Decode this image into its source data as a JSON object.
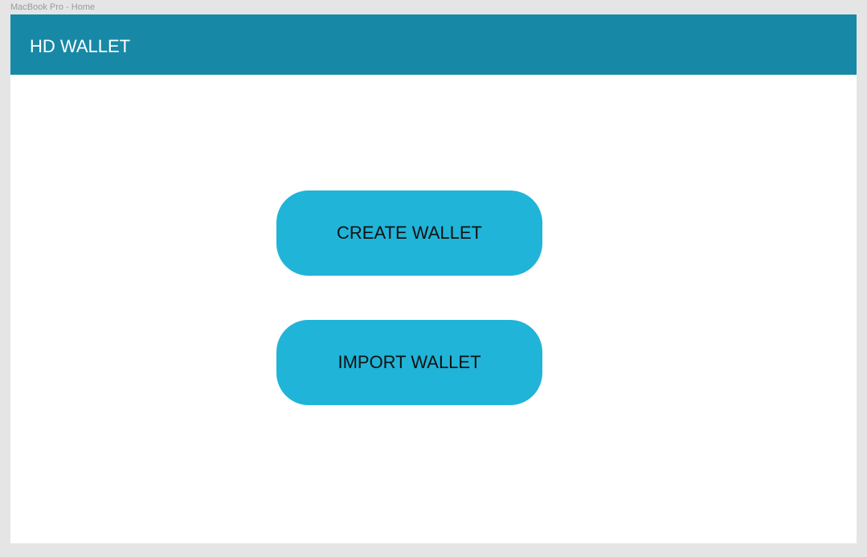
{
  "canvas": {
    "frame_label": "MacBook Pro - Home"
  },
  "header": {
    "title": "HD WALLET"
  },
  "main": {
    "create_label": "CREATE WALLET",
    "import_label": "IMPORT WALLET"
  },
  "colors": {
    "canvas_background": "#e5e5e5",
    "header_background": "#1789a6",
    "button_background": "#20b4d8",
    "page_background": "#ffffff"
  }
}
